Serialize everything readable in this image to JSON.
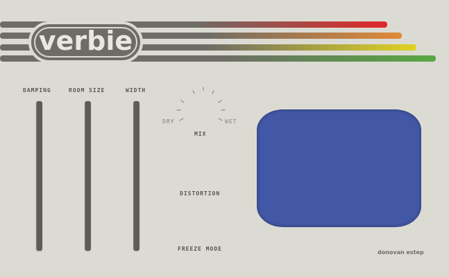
{
  "app": {
    "title": "verbie"
  },
  "controls": {
    "damping": "DAMPING",
    "room_size": "ROOM SIZE",
    "width": "WIDTH",
    "dry": "DRY",
    "wet": "WET",
    "mix": "MIX",
    "distortion": "DISTORTION",
    "freeze_mode": "FREEZE MODE"
  },
  "credit": "donovan estep",
  "colors": {
    "background": "#dcdbd3",
    "stripe_gray": "#6d6c66",
    "red": "#e02828",
    "orange": "#e08a38",
    "yellow": "#e0d322",
    "green": "#58a844",
    "screen_blue": "#4258a6"
  }
}
